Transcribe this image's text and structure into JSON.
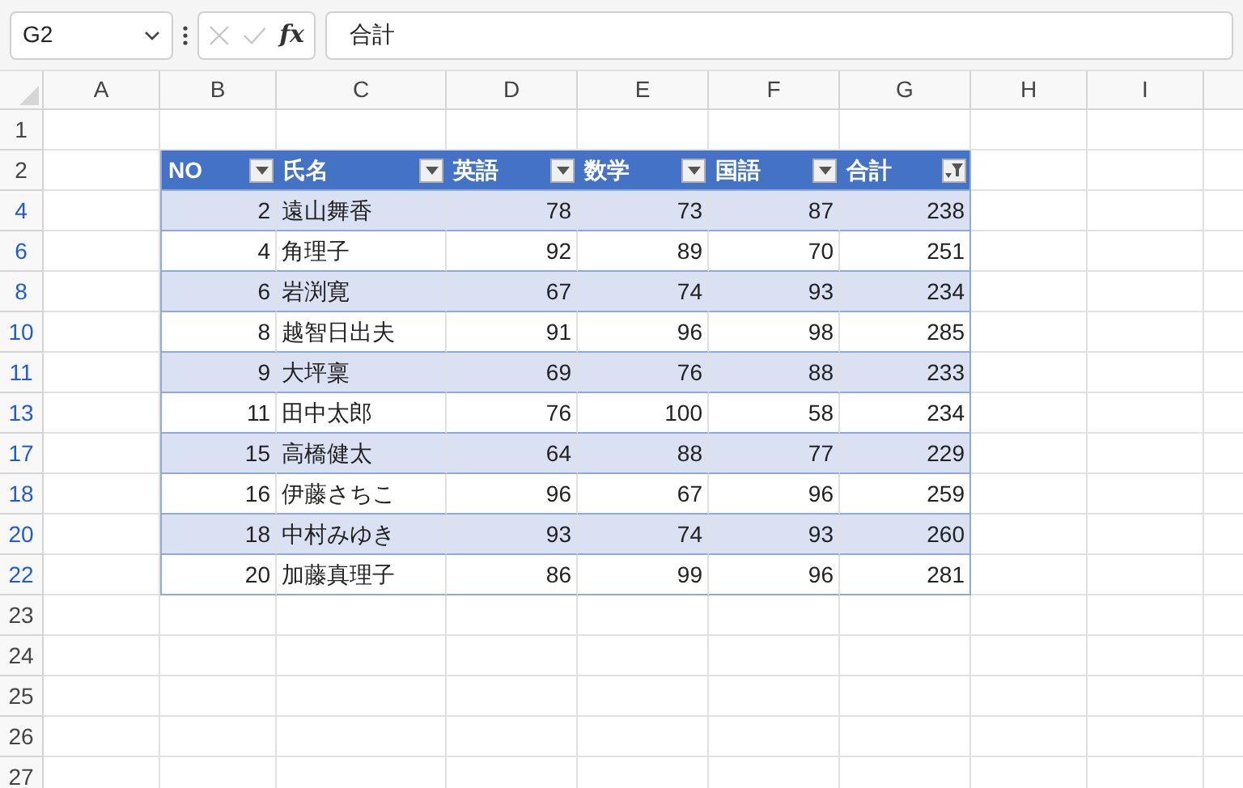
{
  "name_box": {
    "value": "G2"
  },
  "formula_bar": {
    "function_label": "fx",
    "value": "合計"
  },
  "column_headers": [
    "A",
    "B",
    "C",
    "D",
    "E",
    "F",
    "G",
    "H",
    "I"
  ],
  "table": {
    "columns": [
      {
        "label": "NO",
        "filter_applied": false
      },
      {
        "label": "氏名",
        "filter_applied": false
      },
      {
        "label": "英語",
        "filter_applied": false
      },
      {
        "label": "数学",
        "filter_applied": false
      },
      {
        "label": "国語",
        "filter_applied": false
      },
      {
        "label": "合計",
        "filter_applied": true
      }
    ]
  },
  "rows": [
    {
      "number": "1",
      "filtered": false,
      "kind": "empty"
    },
    {
      "number": "2",
      "filtered": false,
      "kind": "header"
    },
    {
      "number": "4",
      "filtered": true,
      "kind": "record",
      "cells": [
        "2",
        "遠山舞香",
        "78",
        "73",
        "87",
        "238"
      ]
    },
    {
      "number": "6",
      "filtered": true,
      "kind": "record",
      "cells": [
        "4",
        "角理子",
        "92",
        "89",
        "70",
        "251"
      ]
    },
    {
      "number": "8",
      "filtered": true,
      "kind": "record",
      "cells": [
        "6",
        "岩渕寛",
        "67",
        "74",
        "93",
        "234"
      ]
    },
    {
      "number": "10",
      "filtered": true,
      "kind": "record",
      "cells": [
        "8",
        "越智日出夫",
        "91",
        "96",
        "98",
        "285"
      ]
    },
    {
      "number": "11",
      "filtered": true,
      "kind": "record",
      "cells": [
        "9",
        "大坪稟",
        "69",
        "76",
        "88",
        "233"
      ]
    },
    {
      "number": "13",
      "filtered": true,
      "kind": "record",
      "cells": [
        "11",
        "田中太郎",
        "76",
        "100",
        "58",
        "234"
      ]
    },
    {
      "number": "17",
      "filtered": true,
      "kind": "record",
      "cells": [
        "15",
        "高橋健太",
        "64",
        "88",
        "77",
        "229"
      ]
    },
    {
      "number": "18",
      "filtered": true,
      "kind": "record",
      "cells": [
        "16",
        "伊藤さちこ",
        "96",
        "67",
        "96",
        "259"
      ]
    },
    {
      "number": "20",
      "filtered": true,
      "kind": "record",
      "cells": [
        "18",
        "中村みゆき",
        "93",
        "74",
        "93",
        "260"
      ]
    },
    {
      "number": "22",
      "filtered": true,
      "kind": "record",
      "cells": [
        "20",
        "加藤真理子",
        "86",
        "99",
        "96",
        "281"
      ]
    },
    {
      "number": "23",
      "filtered": false,
      "kind": "empty"
    },
    {
      "number": "24",
      "filtered": false,
      "kind": "empty"
    },
    {
      "number": "25",
      "filtered": false,
      "kind": "empty"
    },
    {
      "number": "26",
      "filtered": false,
      "kind": "empty"
    },
    {
      "number": "27",
      "filtered": false,
      "kind": "empty"
    }
  ]
}
